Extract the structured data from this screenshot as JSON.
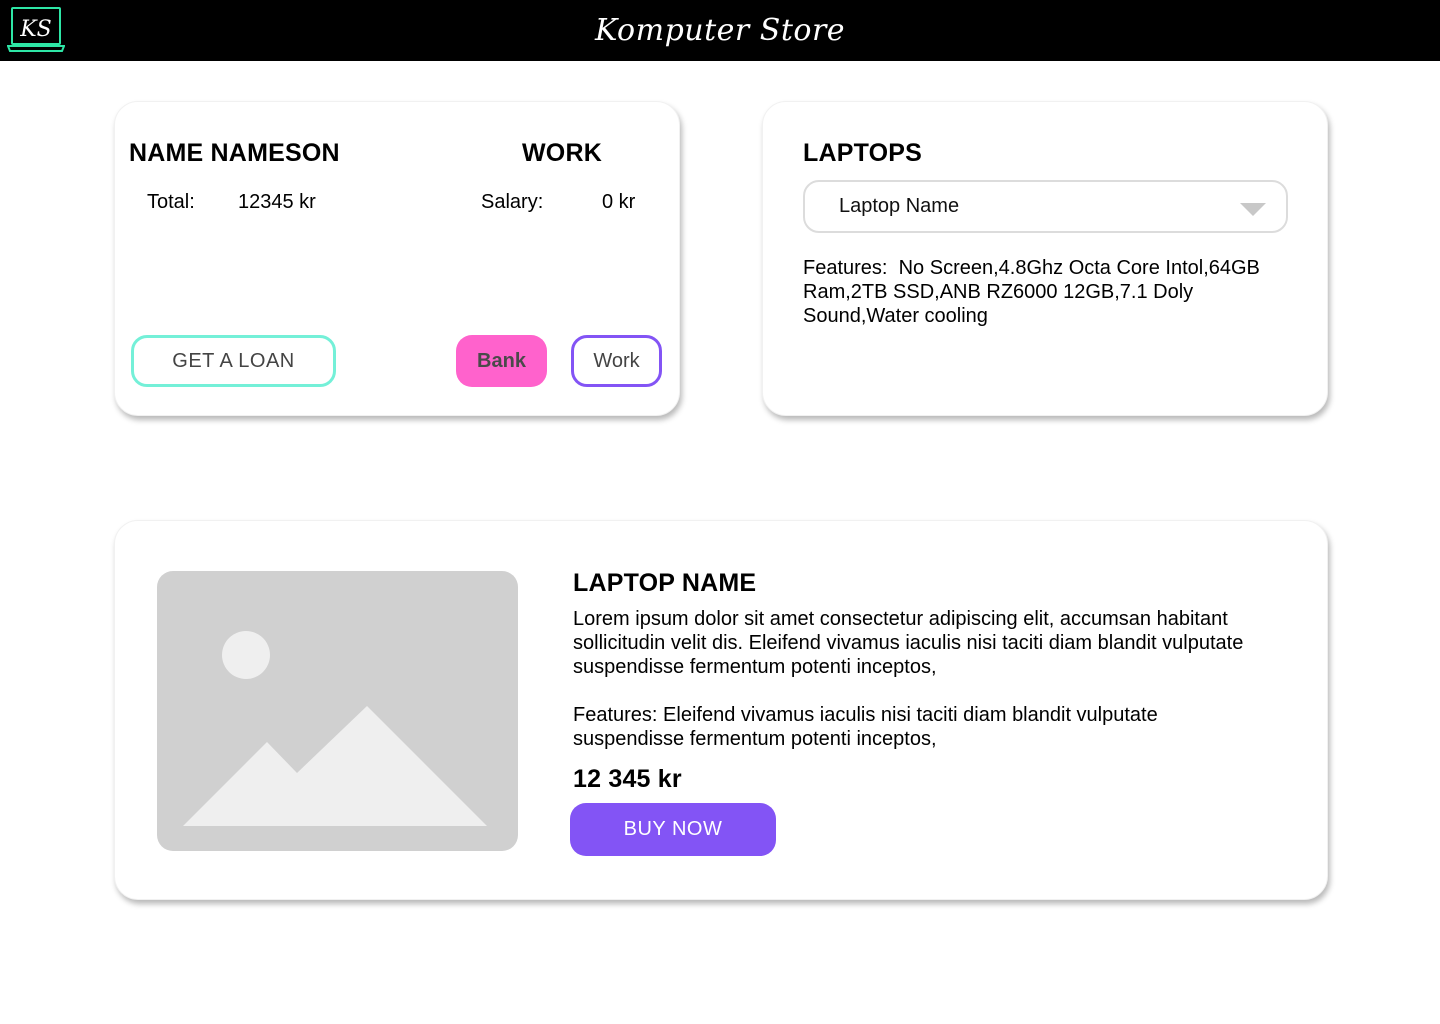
{
  "header": {
    "logo_text": "KS",
    "brand_title": "Komputer Store"
  },
  "bank": {
    "name": "NAME NAMESON",
    "total_label": "Total:",
    "total_value": "12345 kr",
    "loan_button": "GET A LOAN",
    "bank_button": "Bank"
  },
  "work": {
    "title": "WORK",
    "salary_label": "Salary:",
    "salary_value": "0 kr",
    "work_button": "Work"
  },
  "laptops": {
    "title": "LAPTOPS",
    "selected": "Laptop Name",
    "features_label": "Features:",
    "features_text": "No Screen,4.8Ghz Octa Core Intol,64GB Ram,2TB SSD,ANB RZ6000 12GB,7.1 Doly Sound,Water cooling"
  },
  "product": {
    "name": "LAPTOP NAME",
    "description": "Lorem ipsum dolor sit amet consectetur adipiscing elit, accumsan habitant sollicitudin velit dis. Eleifend vivamus iaculis nisi taciti diam blandit vulputate suspendisse fermentum potenti inceptos,",
    "features": "Features: Eleifend vivamus iaculis nisi taciti diam blandit vulputate suspendisse fermentum potenti inceptos,",
    "price": "12 345 kr",
    "buy_button": "BUY NOW"
  },
  "colors": {
    "header_bg": "#000000",
    "logo_accent": "#2ee6a6",
    "loan_border": "#74f0d8",
    "bank_bg": "#ff62cc",
    "work_border": "#8354f5",
    "buy_bg": "#8354f5",
    "image_placeholder": "#d0d0d0"
  },
  "icons": {
    "logo": "laptop-monogram-icon",
    "dropdown": "caret-down-icon",
    "image": "image-placeholder-icon"
  }
}
